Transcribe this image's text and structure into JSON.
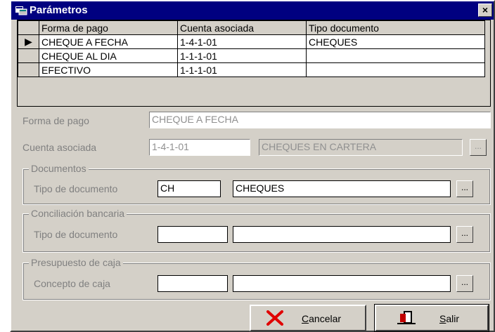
{
  "window": {
    "title": "Parámetros",
    "close_glyph": "×"
  },
  "grid": {
    "columns": [
      "Forma de pago",
      "Cuenta asociada",
      "Tipo documento"
    ],
    "rows": [
      {
        "indicator": "▶",
        "forma_pago": "CHEQUE A FECHA",
        "cuenta": "1-4-1-01",
        "tipo": "CHEQUES"
      },
      {
        "indicator": "",
        "forma_pago": "CHEQUE AL DIA",
        "cuenta": "1-1-1-01",
        "tipo": ""
      },
      {
        "indicator": "",
        "forma_pago": "EFECTIVO",
        "cuenta": "1-1-1-01",
        "tipo": ""
      }
    ]
  },
  "form": {
    "forma_pago_label": "Forma de pago",
    "forma_pago_value": "CHEQUE A FECHA",
    "cuenta_label": "Cuenta asociada",
    "cuenta_code": "1-4-1-01",
    "cuenta_desc": "CHEQUES EN CARTERA",
    "lookup_glyph": "..."
  },
  "documentos": {
    "title": "Documentos",
    "tipo_label": "Tipo de documento",
    "code": "CH",
    "desc": "CHEQUES"
  },
  "conciliacion": {
    "title": "Conciliación bancaria",
    "tipo_label": "Tipo de documento",
    "code": "",
    "desc": ""
  },
  "presupuesto": {
    "title": "Presupuesto de caja",
    "concepto_label": "Concepto de caja",
    "code": "",
    "desc": ""
  },
  "buttons": {
    "cancel_underline": "C",
    "cancel_rest": "ancelar",
    "exit_underline": "S",
    "exit_rest": "alir"
  },
  "icons": {
    "title": "window-app-icon",
    "cancel": "red-x-icon",
    "exit": "door-exit-icon"
  },
  "colors": {
    "titlebar": "#000080",
    "face": "#d4d0c8",
    "cancel_x": "#e00000"
  }
}
